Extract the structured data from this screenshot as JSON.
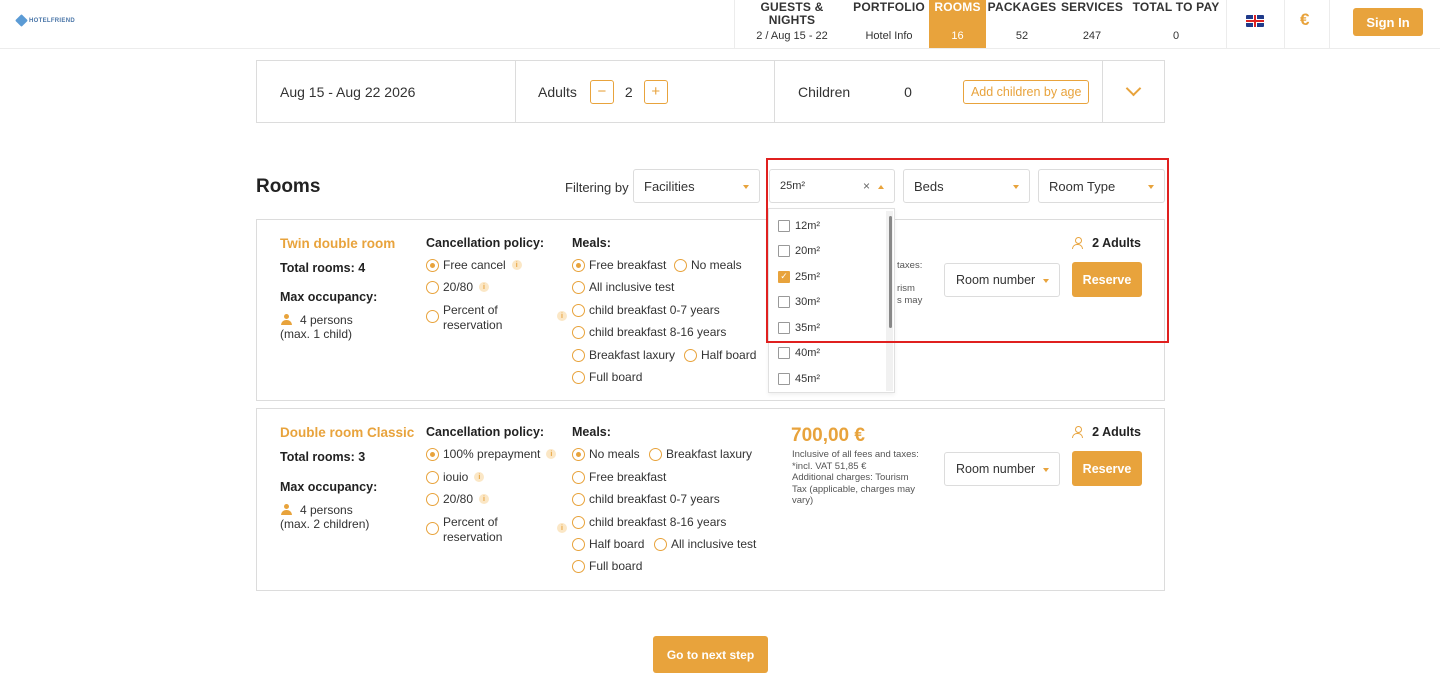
{
  "brand": {
    "logo_text": "HOTELFRIEND",
    "accent": "#e8a33c"
  },
  "steps": [
    {
      "title": "GUESTS &\nNIGHTS",
      "value": "2 / Aug 15 - 22"
    },
    {
      "title": "PORTFOLIO",
      "value": "Hotel Info"
    },
    {
      "title": "ROOMS",
      "value": "16"
    },
    {
      "title": "PACKAGES",
      "value": "52"
    },
    {
      "title": "SERVICES",
      "value": "247"
    },
    {
      "title": "TOTAL TO PAY",
      "value": "0"
    }
  ],
  "header": {
    "language_icon": "uk-flag-icon",
    "currency": "€",
    "signin_label": "Sign In"
  },
  "search": {
    "dates": "Aug 15 - Aug 22 2026",
    "adults_label": "Adults",
    "adults_value": "2",
    "minus": "−",
    "plus": "+",
    "children_label": "Children",
    "children_value": "0",
    "add_children_label": "Add children by age"
  },
  "rooms_section": {
    "title": "Rooms",
    "filter_label": "Filtering by",
    "filters": {
      "facilities": "Facilities",
      "size": "25m²",
      "beds": "Beds",
      "room_type": "Room Type"
    },
    "size_options": [
      {
        "label": "12m²",
        "checked": false
      },
      {
        "label": "20m²",
        "checked": false
      },
      {
        "label": "25m²",
        "checked": true
      },
      {
        "label": "30m²",
        "checked": false
      },
      {
        "label": "35m²",
        "checked": false
      },
      {
        "label": "40m²",
        "checked": false
      },
      {
        "label": "45m²",
        "checked": false
      }
    ]
  },
  "rooms": [
    {
      "name": "Twin double room",
      "total_rooms": "Total rooms: 4",
      "max_occupancy_label": "Max occupancy:",
      "occupancy_line1": "4 persons",
      "occupancy_line2": "(max. 1 child)",
      "cancellation_label": "Cancellation policy:",
      "cancellation": [
        "Free cancel",
        "20/80",
        "Percent of",
        "reservation"
      ],
      "meals_label": "Meals:",
      "meals": [
        "Free breakfast",
        "No meals",
        "All inclusive test",
        "child breakfast 0-7 years",
        "child breakfast 8-16 years",
        "Breakfast laxury",
        "Half board",
        "Full board"
      ],
      "price_partial": [
        "taxes:",
        "rism",
        "s may"
      ],
      "adults": "2 Adults",
      "room_number_label": "Room number",
      "reserve_label": "Reserve"
    },
    {
      "name": "Double room Classic",
      "total_rooms": "Total rooms: 3",
      "max_occupancy_label": "Max occupancy:",
      "occupancy_line1": "4 persons",
      "occupancy_line2": "(max. 2 children)",
      "cancellation_label": "Cancellation policy:",
      "cancellation": [
        "100% prepayment",
        "iouio",
        "20/80",
        "Percent of",
        "reservation"
      ],
      "meals_label": "Meals:",
      "meals": [
        "No meals",
        "Breakfast laxury",
        "Free breakfast",
        "child breakfast 0-7 years",
        "child breakfast 8-16 years",
        "Half board",
        "All inclusive test",
        "Full board"
      ],
      "price": "700,00 €",
      "price_note": [
        "Inclusive of all fees and taxes:",
        "*incl. VAT 51,85 €",
        "Additional charges: Tourism",
        "Tax (applicable, charges may",
        "vary)"
      ],
      "adults": "2 Adults",
      "room_number_label": "Room number",
      "reserve_label": "Reserve"
    }
  ],
  "next_step_label": "Go to next step"
}
